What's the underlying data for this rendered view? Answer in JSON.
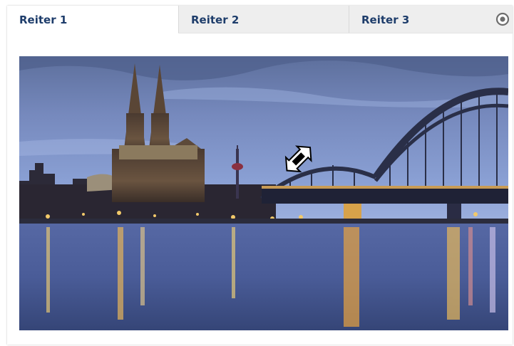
{
  "tabs": [
    {
      "label": "Reiter 1",
      "active": true
    },
    {
      "label": "Reiter 2",
      "active": false
    },
    {
      "label": "Reiter 3",
      "active": false
    }
  ],
  "menu_icon": "circle-dot-icon",
  "image": {
    "subject": "cologne-cathedral-hohenzollern-bridge-night"
  },
  "cursor": "resize-diagonal-icon",
  "colors": {
    "tab_text": "#1e3d6b",
    "tab_bar": "#eeeeee",
    "active_tab": "#ffffff"
  }
}
